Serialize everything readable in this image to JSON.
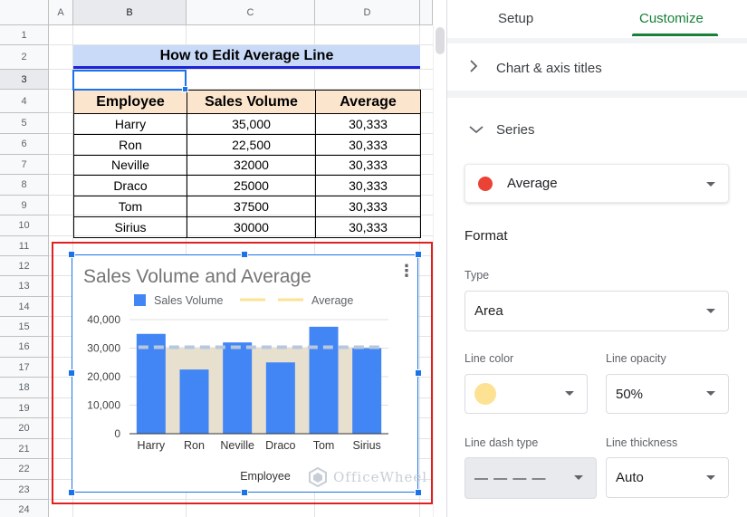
{
  "sheet": {
    "columns": [
      "A",
      "B",
      "C",
      "D"
    ],
    "rows": [
      "1",
      "2",
      "3",
      "4",
      "5",
      "6",
      "7",
      "8",
      "9",
      "10",
      "11",
      "12",
      "13",
      "14",
      "15",
      "16",
      "17",
      "18",
      "19",
      "20",
      "21",
      "22",
      "23",
      "24"
    ],
    "title": "How to Edit Average Line",
    "headers": [
      "Employee",
      "Sales Volume",
      "Average"
    ],
    "data": [
      [
        "Harry",
        "35,000",
        "30,333"
      ],
      [
        "Ron",
        "22,500",
        "30,333"
      ],
      [
        "Neville",
        "32000",
        "30,333"
      ],
      [
        "Draco",
        "25000",
        "30,333"
      ],
      [
        "Tom",
        "37500",
        "30,333"
      ],
      [
        "Sirius",
        "30000",
        "30,333"
      ]
    ]
  },
  "chart_data": {
    "type": "bar",
    "title": "Sales Volume and Average",
    "xlabel": "Employee",
    "ylabel": "",
    "categories": [
      "Harry",
      "Ron",
      "Neville",
      "Draco",
      "Tom",
      "Sirius"
    ],
    "series": [
      {
        "name": "Sales Volume",
        "type": "bar",
        "color": "#4285f4",
        "values": [
          35000,
          22500,
          32000,
          25000,
          37500,
          30000
        ]
      },
      {
        "name": "Average",
        "type": "area",
        "color": "#fde293",
        "values": [
          30333,
          30333,
          30333,
          30333,
          30333,
          30333
        ]
      }
    ],
    "ylim": [
      0,
      40000
    ],
    "yticks": [
      0,
      10000,
      20000,
      30000,
      40000
    ],
    "ytick_labels": [
      "0",
      "10,000",
      "20,000",
      "30,000",
      "40,000"
    ],
    "legend": "top",
    "grid": true
  },
  "watermark": "OfficeWheel",
  "panel": {
    "tabs": [
      "Setup",
      "Customize"
    ],
    "active_tab": "Customize",
    "chart_axis_titles": "Chart & axis titles",
    "series_label": "Series",
    "series_selected": "Average",
    "series_color": "#ea4335",
    "format_label": "Format",
    "type_label": "Type",
    "type_value": "Area",
    "line_color_label": "Line color",
    "line_color_value": "#fde293",
    "line_opacity_label": "Line opacity",
    "line_opacity_value": "50%",
    "line_dash_label": "Line dash type",
    "line_dash_value": "— — — —",
    "line_thickness_label": "Line thickness",
    "line_thickness_value": "Auto"
  }
}
